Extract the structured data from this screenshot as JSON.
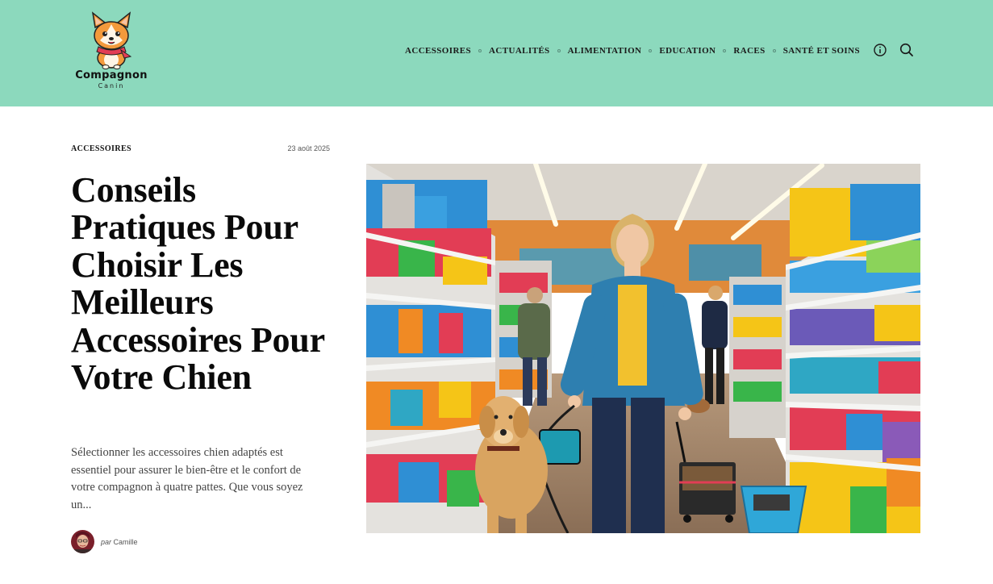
{
  "header": {
    "logo_text": "Compagnon",
    "logo_subtext": "Canin",
    "nav": [
      {
        "label": "ACCESSOIRES"
      },
      {
        "label": "ACTUALITÉS"
      },
      {
        "label": "ALIMENTATION"
      },
      {
        "label": "EDUCATION"
      },
      {
        "label": "RACES"
      },
      {
        "label": "SANTÉ ET SOINS"
      }
    ],
    "icons": [
      "info-icon",
      "search-icon"
    ]
  },
  "article": {
    "category": "ACCESSOIRES",
    "date": "23 août 2025",
    "title": "Conseils Pratiques Pour Choisir Les Meilleurs Accessoires Pour Votre Chien",
    "excerpt": "Sélectionner les accessoires chien adaptés est essentiel pour assurer le bien-être et le confort de votre compagnon à quatre pattes. Que vous soyez un...",
    "author_prefix": "par",
    "author": "Camille"
  },
  "colors": {
    "header_bg": "#8cd9bd",
    "text": "#111111",
    "muted": "#555555"
  }
}
